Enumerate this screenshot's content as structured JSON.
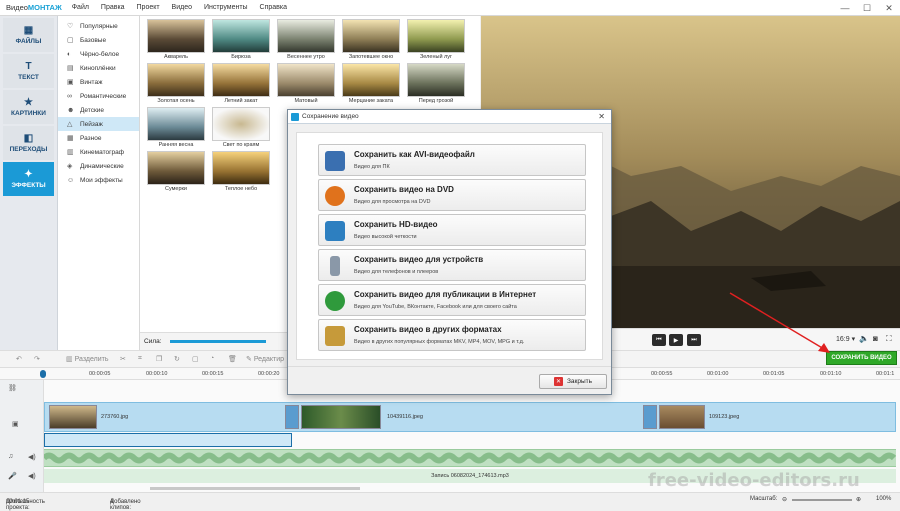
{
  "app": {
    "name_prefix": "Видео",
    "name_suffix": "МОНТАЖ",
    "menu": [
      "Файл",
      "Правка",
      "Проект",
      "Видео",
      "Инструменты",
      "Справка"
    ]
  },
  "sidebar": {
    "items": [
      {
        "label": "ФАЙЛЫ",
        "icon": "files-icon"
      },
      {
        "label": "ТЕКСТ",
        "icon": "text-icon"
      },
      {
        "label": "КАРТИНКИ",
        "icon": "pictures-icon"
      },
      {
        "label": "ПЕРЕХОДЫ",
        "icon": "transitions-icon"
      },
      {
        "label": "ЭФФЕКТЫ",
        "icon": "effects-icon",
        "active": true
      }
    ]
  },
  "effects": {
    "categories": [
      "Популярные",
      "Базовые",
      "Чёрно-белое",
      "Киноплёнки",
      "Винтаж",
      "Романтические",
      "Детские",
      "Пейзаж",
      "Разное",
      "Кинематограф",
      "Динамические",
      "Мои эффекты"
    ],
    "selected": "Пейзаж",
    "thumbs": [
      "Акварель",
      "Бирюза",
      "Весеннее утро",
      "Запотевшее окно",
      "Зеленый луг",
      "Золотая осень",
      "Летний закат",
      "Матовый",
      "Мерцание заката",
      "Перед грозой",
      "Ранняя весна",
      "Свет по краям",
      "Сумерки",
      "Теплое небо"
    ],
    "strength_label": "Сила:"
  },
  "player": {
    "ratio": "16:9",
    "save_button": "СОХРАНИТЬ ВИДЕО"
  },
  "toolbar": {
    "split": "Разделить",
    "edit": "Редактир"
  },
  "ruler": [
    "00:00:05",
    "00:00:10",
    "00:00:15",
    "00:00:20",
    "00:00:55",
    "00:01:00",
    "00:01:05",
    "00:01:10",
    "00:01:1"
  ],
  "timeline": {
    "clips": [
      "273760.jpg",
      "10439116.jpeg",
      "109123.jpeg"
    ],
    "audio_label": "Запись 06082024_174613.mp3"
  },
  "status": {
    "duration_label": "Длительность проекта:",
    "duration": "00:01:15",
    "clips_label": "Добавлено клипов:",
    "clips": "4",
    "scale_label": "Масштаб:",
    "zoom": "100%"
  },
  "dialog": {
    "title": "Сохранение видео",
    "options": [
      {
        "title": "Сохранить как AVI-видеофайл",
        "sub": "Видео для ПК",
        "icon": "avi-file-icon",
        "color": "#3a6fb0"
      },
      {
        "title": "Сохранить видео на DVD",
        "sub": "Видео для просмотра на DVD",
        "icon": "dvd-icon",
        "color": "#e0721c"
      },
      {
        "title": "Сохранить HD-видео",
        "sub": "Видео высокой четкости",
        "icon": "hd-monitor-icon",
        "color": "#2d7fc0"
      },
      {
        "title": "Сохранить видео для устройств",
        "sub": "Видео для телефонов и плееров",
        "icon": "phone-icon",
        "color": "#8a98a8"
      },
      {
        "title": "Сохранить видео для публикации в Интернет",
        "sub": "Видео для YouTube, ВКонтакте, Facebook или для своего сайта",
        "icon": "globe-icon",
        "color": "#2f9a3c"
      },
      {
        "title": "Сохранить видео в других форматах",
        "sub": "Видео в других популярных форматах MKV, MP4, MOV, MPG и т.д.",
        "icon": "gear-film-icon",
        "color": "#c69a3a"
      }
    ],
    "close": "Закрыть"
  },
  "watermark": "free-video-editors.ru"
}
